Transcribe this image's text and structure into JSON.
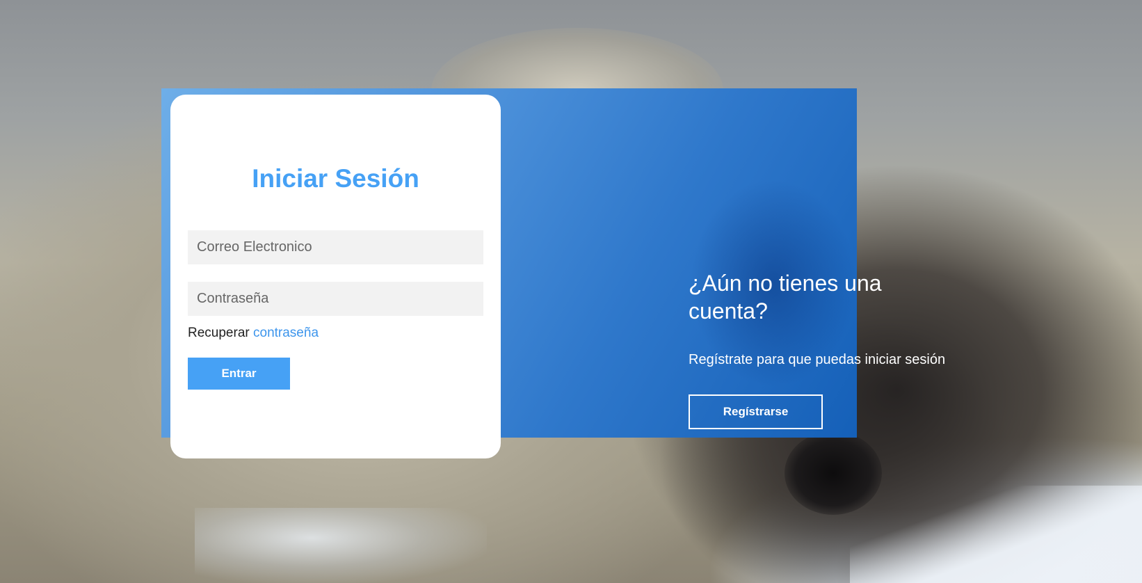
{
  "login": {
    "title": "Iniciar Sesión",
    "email_placeholder": "Correo Electronico",
    "password_placeholder": "Contraseña",
    "recover_prefix": "Recuperar",
    "recover_link": "contraseña",
    "submit_label": "Entrar"
  },
  "register": {
    "heading": "¿Aún no tienes una cuenta?",
    "description": "Regístrate para que puedas iniciar sesión",
    "button_label": "Regístrarse"
  },
  "colors": {
    "accent": "#46a1f5",
    "panel_start": "#6eaee8",
    "panel_end": "#1560b8"
  }
}
